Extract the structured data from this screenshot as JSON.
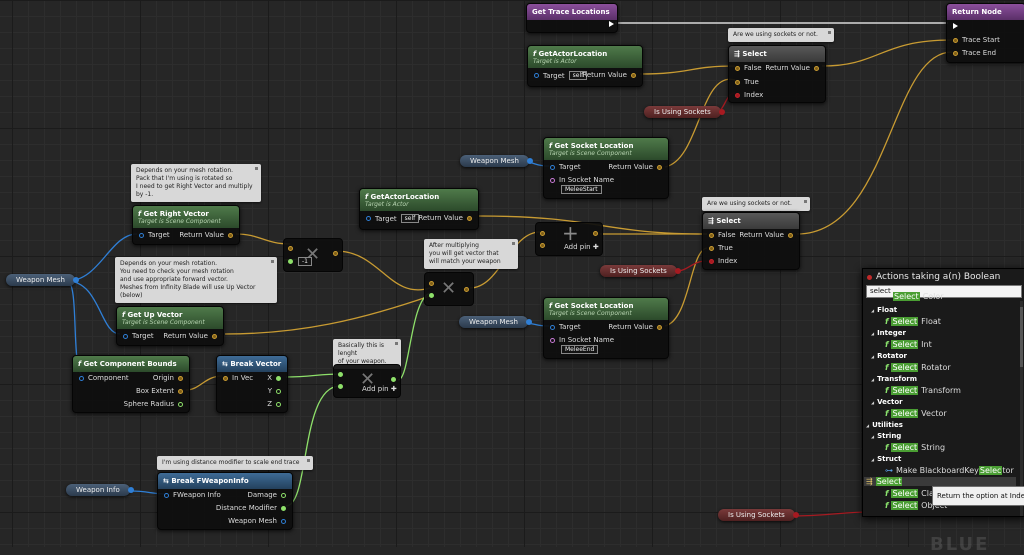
{
  "colors": {
    "exec": "#ffffff",
    "object": "#2f7fd6",
    "bool": "#a71a21",
    "vector": "#c89b32",
    "float": "#8ee06a",
    "function_header": "#4f7a4a",
    "struct_header": "#3e6b96",
    "event_header": "#8b4f9c"
  },
  "nodes": {
    "get_trace_locations": {
      "title": "Get Trace Locations"
    },
    "return_node": {
      "title": "Return Node",
      "pins": [
        "Trace Start",
        "Trace End"
      ]
    },
    "get_actor_location_1": {
      "title": "GetActorLocation",
      "subtitle": "Target is Actor",
      "target": "Target",
      "target_value": "self",
      "return": "Return Value"
    },
    "get_actor_location_2": {
      "title": "GetActorLocation",
      "subtitle": "Target is Actor",
      "target": "Target",
      "target_value": "self",
      "return": "Return Value"
    },
    "select_1": {
      "title": "Select",
      "pins": [
        "False",
        "True",
        "Index"
      ],
      "return": "Return Value"
    },
    "select_2": {
      "title": "Select",
      "pins": [
        "False",
        "True",
        "Index"
      ],
      "return": "Return Value"
    },
    "get_socket_location_1": {
      "title": "Get Socket Location",
      "subtitle": "Target is Scene Component",
      "target": "Target",
      "socket_label": "In Socket Name",
      "socket_value": "MeleeStart",
      "return": "Return Value"
    },
    "get_socket_location_2": {
      "title": "Get Socket Location",
      "subtitle": "Target is Scene Component",
      "target": "Target",
      "socket_label": "In Socket Name",
      "socket_value": "MeleeEnd",
      "return": "Return Value"
    },
    "get_right_vector": {
      "title": "Get Right Vector",
      "subtitle": "Target is Scene Component",
      "target": "Target",
      "return": "Return Value"
    },
    "get_up_vector": {
      "title": "Get Up Vector",
      "subtitle": "Target is Scene Component",
      "target": "Target",
      "return": "Return Value"
    },
    "get_component_bounds": {
      "title": "Get Component Bounds",
      "input": "Component",
      "outputs": [
        "Origin",
        "Box Extent",
        "Sphere Radius"
      ]
    },
    "break_vector": {
      "title": "Break Vector",
      "input": "In Vec",
      "outputs": [
        "X",
        "Y",
        "Z"
      ]
    },
    "break_weaponinfo": {
      "title": "Break FWeaponInfo",
      "input": "FWeapon Info",
      "outputs": [
        "Damage",
        "Distance Modifier",
        "Weapon Mesh"
      ]
    },
    "multiply_value": "-1",
    "add_pin_label": "Add pin"
  },
  "variables": {
    "weapon_mesh_1": "Weapon Mesh",
    "weapon_mesh_2": "Weapon Mesh",
    "weapon_mesh_3": "Weapon Mesh",
    "is_using_sockets_1": "Is Using Sockets",
    "is_using_sockets_2": "Is Using Sockets",
    "is_using_sockets_3": "Is Using Sockets",
    "weapon_info": "Weapon Info"
  },
  "comments": {
    "sockets_1": "Are we using sockets or not.",
    "sockets_2": "Are we using sockets or not.",
    "right_vector": "Depends on your mesh rotation.\nPack that I'm using is rotated so\nI need to get Right Vector and multiply\nby -1.",
    "up_vector": "Depends on your mesh rotation.\nYou need to check your mesh rotation\nand use appropriate forward vector.\nMeshes from Infinity Blade will use Up Vector\n(below)",
    "multiply": "After multiplying\nyou will get vector that\nwill match your weapon",
    "length": "Basically this is lenght\nof your weapon.",
    "distance": "I'm using distance modifier to scale end trace"
  },
  "menu": {
    "title": "Actions taking a(n) Boolean",
    "search_value": "select",
    "items": [
      {
        "type": "item",
        "label": "Select Color",
        "partial": true
      },
      {
        "type": "cat",
        "label": "Float"
      },
      {
        "type": "item",
        "prefix": "Select",
        "label": " Float"
      },
      {
        "type": "cat",
        "label": "Integer"
      },
      {
        "type": "item",
        "prefix": "Select",
        "label": " Int"
      },
      {
        "type": "cat",
        "label": "Rotator"
      },
      {
        "type": "item",
        "prefix": "Select",
        "label": " Rotator"
      },
      {
        "type": "cat",
        "label": "Transform"
      },
      {
        "type": "item",
        "prefix": "Select",
        "label": " Transform"
      },
      {
        "type": "cat",
        "label": "Vector"
      },
      {
        "type": "item",
        "prefix": "Select",
        "label": " Vector"
      },
      {
        "type": "top",
        "label": "Utilities"
      },
      {
        "type": "cat",
        "label": "String"
      },
      {
        "type": "item",
        "prefix": "Select",
        "label": " String"
      },
      {
        "type": "cat",
        "label": "Struct"
      },
      {
        "type": "item2",
        "prefix": "Make BlackboardKey",
        "hl": "Selec",
        "suffix": "tor"
      },
      {
        "type": "sel",
        "label": "Select"
      },
      {
        "type": "item",
        "prefix": "Select",
        "label": " Class"
      },
      {
        "type": "item",
        "prefix": "Select",
        "label": " Object"
      }
    ],
    "tooltip": "Return the option at Index, (Index"
  }
}
